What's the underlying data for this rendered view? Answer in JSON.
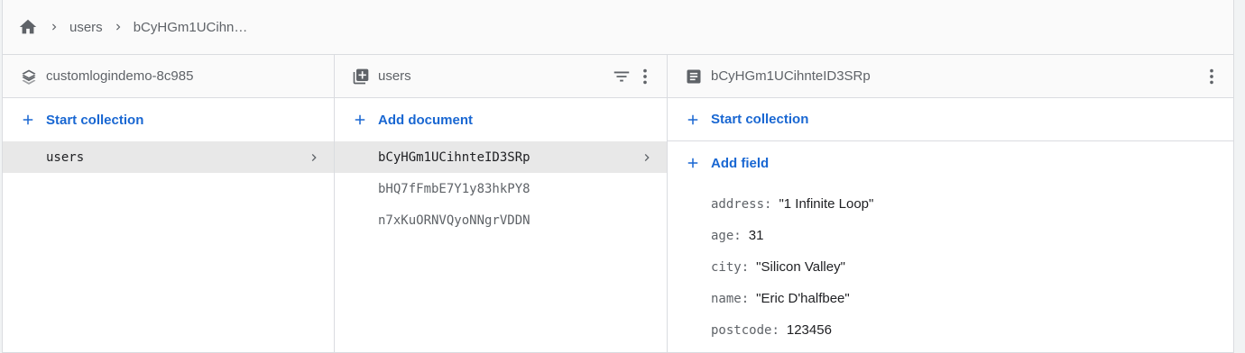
{
  "breadcrumb": {
    "home_icon": "home-icon",
    "items": [
      "users",
      "bCyHGm1UCihn…"
    ]
  },
  "panels": {
    "project": {
      "icon": "firestore-stack-icon",
      "title": "customlogindemo-8c985",
      "action_label": "Start collection",
      "items": [
        {
          "label": "users",
          "selected": true
        }
      ]
    },
    "collection": {
      "icon": "collection-icon",
      "title": "users",
      "action_label": "Add document",
      "items": [
        {
          "label": "bCyHGm1UCihnteID3SRp",
          "selected": true
        },
        {
          "label": "bHQ7fFmbE7Y1y83hkPY8",
          "selected": false
        },
        {
          "label": "n7xKuORNVQyoNNgrVDDN",
          "selected": false
        }
      ]
    },
    "document": {
      "icon": "document-icon",
      "title": "bCyHGm1UCihnteID3SRp",
      "action_label": "Start collection",
      "add_field_label": "Add field",
      "fields": [
        {
          "key": "address",
          "value": "\"1 Infinite Loop\""
        },
        {
          "key": "age",
          "value": "31"
        },
        {
          "key": "city",
          "value": "\"Silicon Valley\""
        },
        {
          "key": "name",
          "value": "\"Eric D'halfbee\""
        },
        {
          "key": "postcode",
          "value": "123456"
        }
      ]
    }
  },
  "colors": {
    "accent": "#1967d2",
    "selected_row": "#e8e8e8",
    "border": "#dadce0",
    "muted_text": "#5f6368"
  }
}
